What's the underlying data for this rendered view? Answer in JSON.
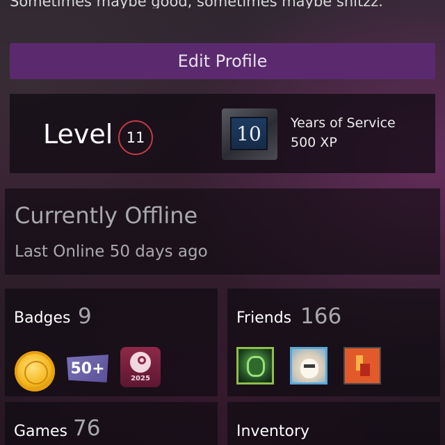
{
  "profile": {
    "bio": "Sometimes maybe good, sometimes maybe shitzz.",
    "edit_label": "Edit Profile"
  },
  "level": {
    "label": "Level",
    "value": "11"
  },
  "featured_badge": {
    "icon_value": "10",
    "title": "Years of Service",
    "xp": "500 XP"
  },
  "status": {
    "main": "Currently Offline",
    "sub": "Last Online 50 days ago"
  },
  "badges": {
    "label": "Badges",
    "count": "9",
    "items": [
      {
        "icon": "gold-coin-badge-icon"
      },
      {
        "icon": "fifty-plus-badge-icon",
        "text": "50+"
      },
      {
        "icon": "steam-2025-badge-icon",
        "text": "2025"
      }
    ]
  },
  "friends": {
    "label": "Friends",
    "count": "166",
    "avatars": [
      {
        "icon": "friend-avatar-green-icon",
        "accent": "#8fbf4a"
      },
      {
        "icon": "friend-avatar-llama-icon",
        "accent": "#5aa7d8"
      },
      {
        "icon": "friend-avatar-pixel-icon",
        "accent": "#e35a2a"
      }
    ]
  },
  "games": {
    "label": "Games",
    "count": "76"
  },
  "inventory": {
    "label": "Inventory"
  },
  "colors": {
    "edit_button": "#5b2a6e",
    "level_ring": "#c73a45",
    "muted_text": "#a9a9ad"
  }
}
